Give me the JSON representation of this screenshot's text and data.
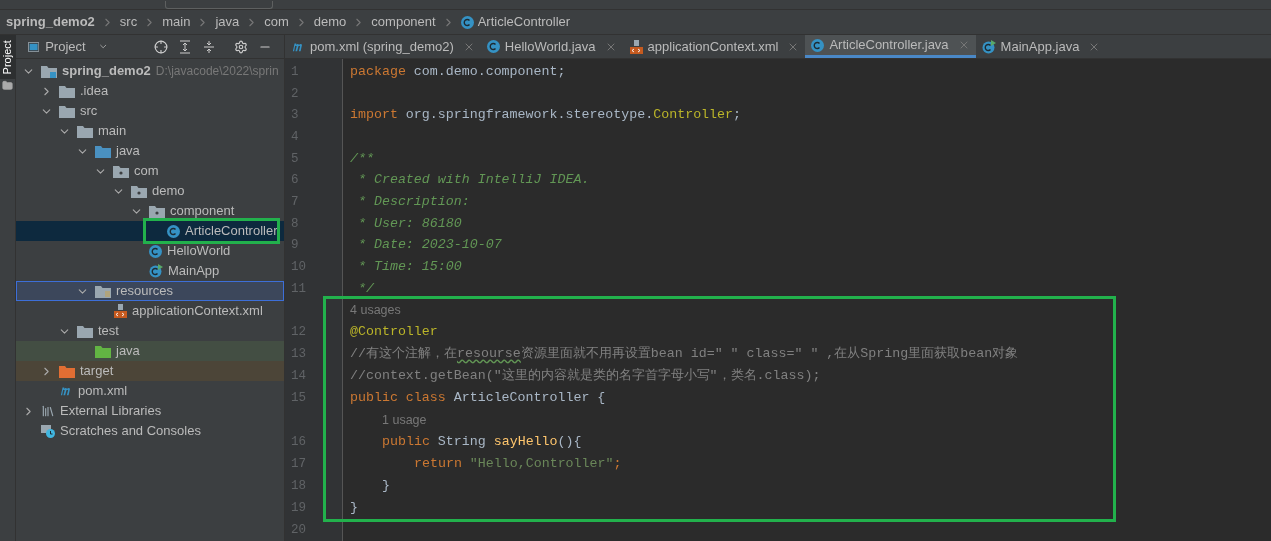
{
  "breadcrumb": [
    {
      "label": "spring_demo2",
      "kind": "project"
    },
    {
      "label": "src",
      "kind": "dir"
    },
    {
      "label": "main",
      "kind": "dir"
    },
    {
      "label": "java",
      "kind": "dir"
    },
    {
      "label": "com",
      "kind": "dir"
    },
    {
      "label": "demo",
      "kind": "dir"
    },
    {
      "label": "component",
      "kind": "dir"
    },
    {
      "label": "ArticleController",
      "kind": "class"
    }
  ],
  "side_stripe": {
    "label": "Project"
  },
  "project_panel": {
    "title": "Project"
  },
  "tabs": [
    {
      "label": "pom.xml (spring_demo2)",
      "kind": "maven",
      "selected": false
    },
    {
      "label": "HelloWorld.java",
      "kind": "class",
      "selected": false
    },
    {
      "label": "applicationContext.xml",
      "kind": "xml",
      "selected": false
    },
    {
      "label": "ArticleController.java",
      "kind": "class",
      "selected": true
    },
    {
      "label": "MainApp.java",
      "kind": "runclass",
      "selected": false
    }
  ],
  "tree": [
    {
      "label": "spring_demo2",
      "path": "D:\\javacode\\2022\\sprin",
      "kind": "module",
      "expanded": true,
      "children": [
        {
          "label": ".idea",
          "kind": "folder",
          "expanded": false
        },
        {
          "label": "src",
          "kind": "folder",
          "expanded": true,
          "children": [
            {
              "label": "main",
              "kind": "folder",
              "expanded": true,
              "children": [
                {
                  "label": "java",
                  "kind": "source",
                  "expanded": true,
                  "children": [
                    {
                      "label": "com",
                      "kind": "package",
                      "expanded": true,
                      "children": [
                        {
                          "label": "demo",
                          "kind": "package",
                          "expanded": true,
                          "children": [
                            {
                              "label": "component",
                              "kind": "package",
                              "expanded": true,
                              "children": [
                                {
                                  "label": "ArticleController",
                                  "kind": "class",
                                  "selected": true,
                                  "outlined": true
                                }
                              ]
                            },
                            {
                              "label": "HelloWorld",
                              "kind": "class",
                              "selected": false
                            },
                            {
                              "label": "MainApp",
                              "kind": "runclass",
                              "selected": false
                            }
                          ]
                        }
                      ]
                    }
                  ]
                },
                {
                  "label": "resources",
                  "kind": "resources",
                  "expanded": true,
                  "focused": true,
                  "children": [
                    {
                      "label": "applicationContext.xml",
                      "kind": "xml"
                    }
                  ]
                }
              ]
            },
            {
              "label": "test",
              "kind": "folder",
              "expanded": true,
              "children": [
                {
                  "label": "java",
                  "kind": "testsource"
                }
              ]
            }
          ]
        },
        {
          "label": "target",
          "kind": "excluded",
          "expanded": false
        },
        {
          "label": "pom.xml",
          "kind": "maven"
        }
      ]
    },
    {
      "label": "External Libraries",
      "kind": "libraries",
      "expanded": false
    },
    {
      "label": "Scratches and Consoles",
      "kind": "scratches"
    }
  ],
  "code": {
    "before": [
      {
        "number": "1",
        "kind": "top",
        "tokens": [
          {
            "kind": "keyword",
            "text": "package "
          },
          {
            "kind": "plain",
            "text": "com.demo.component;"
          }
        ]
      },
      {
        "number": "2",
        "kind": "top"
      },
      {
        "number": "3",
        "kind": "top",
        "tokens": [
          {
            "kind": "keyword",
            "text": "import "
          },
          {
            "kind": "plain",
            "text": "org.springframework.stereotype."
          },
          {
            "kind": "annotation",
            "text": "Controller"
          },
          {
            "kind": "plain",
            "text": ";"
          }
        ]
      },
      {
        "number": "4",
        "kind": "top"
      },
      {
        "number": "5",
        "kind": "top",
        "tokens": [
          {
            "kind": "doc",
            "text": "/**"
          }
        ]
      },
      {
        "number": "6",
        "kind": "top",
        "tokens": [
          {
            "kind": "doc",
            "text": " * Created with IntelliJ IDEA."
          }
        ]
      },
      {
        "number": "7",
        "kind": "top",
        "tokens": [
          {
            "kind": "doc",
            "text": " * Description:"
          }
        ]
      },
      {
        "number": "8",
        "kind": "top",
        "tokens": [
          {
            "kind": "doc",
            "text": " * User: 86180"
          }
        ]
      },
      {
        "number": "9",
        "kind": "top",
        "tokens": [
          {
            "kind": "doc",
            "text": " * Date: 2023-10-07"
          }
        ]
      },
      {
        "number": "10",
        "kind": "top",
        "tokens": [
          {
            "kind": "doc",
            "text": " * Time: 15:00"
          }
        ]
      },
      {
        "number": "11",
        "kind": "top",
        "tokens": [
          {
            "kind": "doc",
            "text": " */"
          }
        ]
      }
    ],
    "framed": [
      {
        "hint": "4 usages",
        "kind": "top"
      },
      {
        "number": "12",
        "kind": "top",
        "tokens": [
          {
            "kind": "annotation",
            "text": "@Controller"
          }
        ]
      },
      {
        "number": "13",
        "kind": "top",
        "tokens": [
          {
            "kind": "comment",
            "text": "//有这个注解，在"
          },
          {
            "kind": "typo",
            "text": "resourse"
          },
          {
            "kind": "comment",
            "text": "资源里面就不用再设置bean id=\" \" class=\" \" ,在从Spring里面获取bean对象"
          }
        ]
      },
      {
        "number": "14",
        "kind": "top",
        "tokens": [
          {
            "kind": "comment",
            "text": "//context.getBean(\"这里的内容就是类的名字首字母小写\"，类名.class);"
          }
        ]
      },
      {
        "number": "15",
        "kind": "top",
        "tokens": [
          {
            "kind": "keyword",
            "text": "public class "
          },
          {
            "kind": "plain",
            "text": "ArticleController {"
          }
        ]
      },
      {
        "hint": "1 usage",
        "kind": "member"
      },
      {
        "number": "16",
        "kind": "member",
        "tokens": [
          {
            "kind": "keyword",
            "text": "public "
          },
          {
            "kind": "plain",
            "text": "String "
          },
          {
            "kind": "function",
            "text": "sayHello"
          },
          {
            "kind": "plain",
            "text": "(){"
          }
        ]
      },
      {
        "number": "17",
        "kind": "body",
        "tokens": [
          {
            "kind": "keyword",
            "text": "return "
          },
          {
            "kind": "string",
            "text": "\"Hello,Controller\""
          },
          {
            "kind": "keyword",
            "text": ";"
          }
        ]
      },
      {
        "number": "18",
        "kind": "member",
        "tokens": [
          {
            "kind": "plain",
            "text": "}"
          }
        ]
      },
      {
        "number": "19",
        "kind": "top",
        "tokens": [
          {
            "kind": "plain",
            "text": "}"
          }
        ]
      }
    ],
    "after": [
      {
        "number": "20"
      }
    ]
  }
}
